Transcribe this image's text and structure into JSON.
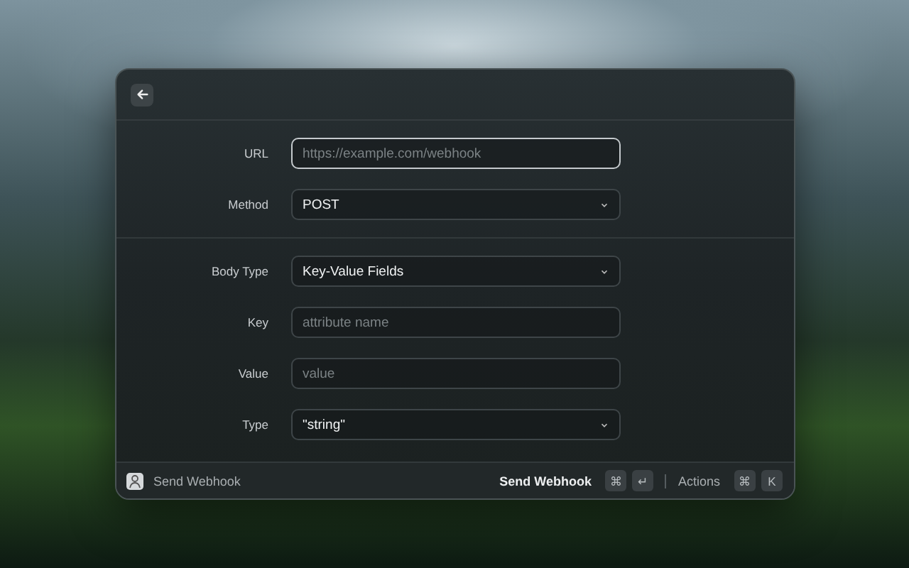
{
  "sections": [
    {
      "fields": [
        {
          "label": "URL",
          "kind": "text",
          "placeholder": "https://example.com/webhook",
          "focused": true
        },
        {
          "label": "Method",
          "kind": "select",
          "value": "POST",
          "focused": false
        }
      ]
    },
    {
      "fields": [
        {
          "label": "Body Type",
          "kind": "select",
          "value": "Key-Value Fields",
          "focused": false
        },
        {
          "label": "Key",
          "kind": "text",
          "placeholder": "attribute name",
          "focused": false
        },
        {
          "label": "Value",
          "kind": "text",
          "placeholder": "value",
          "focused": false
        },
        {
          "label": "Type",
          "kind": "select",
          "value": "\"string\"",
          "focused": false
        }
      ]
    }
  ],
  "footer": {
    "title": "Send Webhook",
    "primary_action": {
      "label": "Send Webhook",
      "keys": [
        "⌘",
        "↵"
      ]
    },
    "actions": {
      "label": "Actions",
      "keys": [
        "⌘",
        "K"
      ]
    }
  }
}
